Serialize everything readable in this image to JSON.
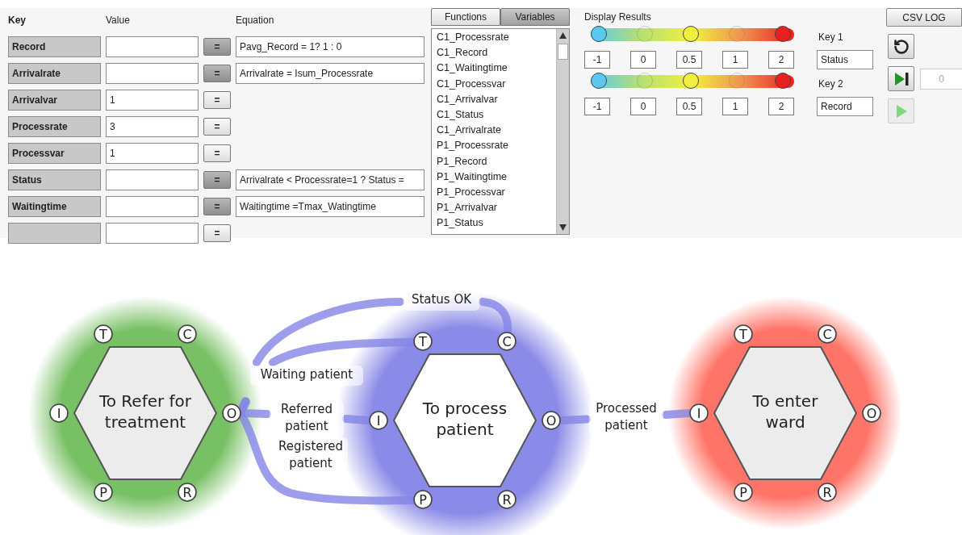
{
  "table": {
    "columns": [
      "Key",
      "Value",
      "Equation"
    ],
    "rows": [
      {
        "key": "Record",
        "button": "=",
        "active": true,
        "equation": "Pavg_Record = 1? 1 : 0"
      },
      {
        "key": "Arrivalrate",
        "button": "=",
        "active": true,
        "equation": "Arrivalrate = Isum_Processrate"
      },
      {
        "key": "Arrivalvar",
        "value": "1",
        "button": "=",
        "active": false
      },
      {
        "key": "Processrate",
        "value": "3",
        "button": "=",
        "active": false
      },
      {
        "key": "Processvar",
        "value": "1",
        "button": "=",
        "active": false
      },
      {
        "key": "Status",
        "button": "=",
        "active": true,
        "equation": "Arrivalrate < Processrate=1 ? Status ="
      },
      {
        "key": "Waitingtime",
        "button": "=",
        "active": true,
        "equation": "Waitingtime =Tmax_Watingtime"
      },
      {
        "button": "=",
        "active": false
      }
    ]
  },
  "browser": {
    "tabs": [
      {
        "label": "Functions",
        "selected": false
      },
      {
        "label": "Variables",
        "selected": true
      }
    ],
    "items": [
      "C1_Processrate",
      "C1_Record",
      "C1_Waitingtime",
      "C1_Processvar",
      "C1_Arrivalvar",
      "C1_Status",
      "C1_Arrivalrate",
      "P1_Processrate",
      "P1_Record",
      "P1_Waitingtime",
      "P1_Processvar",
      "P1_Arrivalvar",
      "P1_Status"
    ]
  },
  "display": {
    "title": "Display Results",
    "scales": [
      {
        "thumbs": [
          {
            "color": "#5ac8f0",
            "on": true
          },
          {
            "color": "#b8dc70",
            "on": false
          },
          {
            "color": "#f0f040",
            "on": true
          },
          {
            "color": "#f09050",
            "on": false
          },
          {
            "color": "#e82020",
            "on": true
          }
        ],
        "values": [
          "-1",
          "0",
          "0.5",
          "1",
          "2"
        ],
        "key_label": "Key 1",
        "key_value": "Status"
      },
      {
        "thumbs": [
          {
            "color": "#5ac8f0",
            "on": true
          },
          {
            "color": "#b8dc70",
            "on": false
          },
          {
            "color": "#f0f040",
            "on": true
          },
          {
            "color": "#f09050",
            "on": false
          },
          {
            "color": "#e82020",
            "on": true
          }
        ],
        "values": [
          "-1",
          "0",
          "0.5",
          "1",
          "2"
        ],
        "key_label": "Key 2",
        "key_value": "Record"
      }
    ]
  },
  "controls": {
    "csv_button": "CSV LOG",
    "step_field": {
      "value": "0",
      "disabled": true
    },
    "play_button": {
      "disabled": true
    }
  },
  "diagram": {
    "nodes": [
      {
        "title_lines": [
          "To Refer for",
          "treatment"
        ],
        "color": "#78c064",
        "selected": false,
        "ports": [
          "T",
          "C",
          "I",
          "O",
          "P",
          "R"
        ]
      },
      {
        "title_lines": [
          "To process",
          "patient"
        ],
        "color": "#8a8ae8",
        "selected": true,
        "ports": [
          "T",
          "C",
          "I",
          "O",
          "P",
          "R"
        ]
      },
      {
        "title_lines": [
          "To enter",
          "ward"
        ],
        "color": "#ff7468",
        "selected": false,
        "ports": [
          "T",
          "C",
          "I",
          "O",
          "P",
          "R"
        ]
      }
    ],
    "edges": [
      {
        "label_lines": [
          "Status OK"
        ]
      },
      {
        "label_lines": [
          "Waiting patient"
        ]
      },
      {
        "label_lines": [
          "Referred",
          "patient"
        ]
      },
      {
        "label_lines": [
          "Registered",
          "patient"
        ]
      },
      {
        "label_lines": [
          "Processed",
          "patient"
        ]
      }
    ]
  }
}
